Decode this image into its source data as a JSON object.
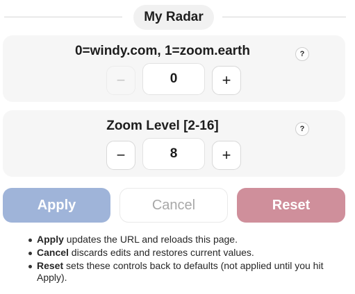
{
  "header": {
    "title": "My Radar"
  },
  "settings": [
    {
      "label": "0=windy.com, 1=zoom.earth",
      "help": "?",
      "minus": "−",
      "plus": "+",
      "value": "0",
      "minus_disabled": true
    },
    {
      "label": "Zoom Level [2-16]",
      "help": "?",
      "minus": "−",
      "plus": "+",
      "value": "8",
      "minus_disabled": false
    }
  ],
  "actions": {
    "apply": "Apply",
    "cancel": "Cancel",
    "reset": "Reset"
  },
  "notes": [
    {
      "term": "Apply",
      "text": " updates the URL and reloads this page."
    },
    {
      "term": "Cancel",
      "text": " discards edits and restores current values."
    },
    {
      "term": "Reset",
      "text": " sets these controls back to defaults (not applied until you hit Apply)."
    }
  ],
  "colors": {
    "apply": "#9fb4d9",
    "reset": "#cf8f9b",
    "card": "#f6f6f6"
  }
}
